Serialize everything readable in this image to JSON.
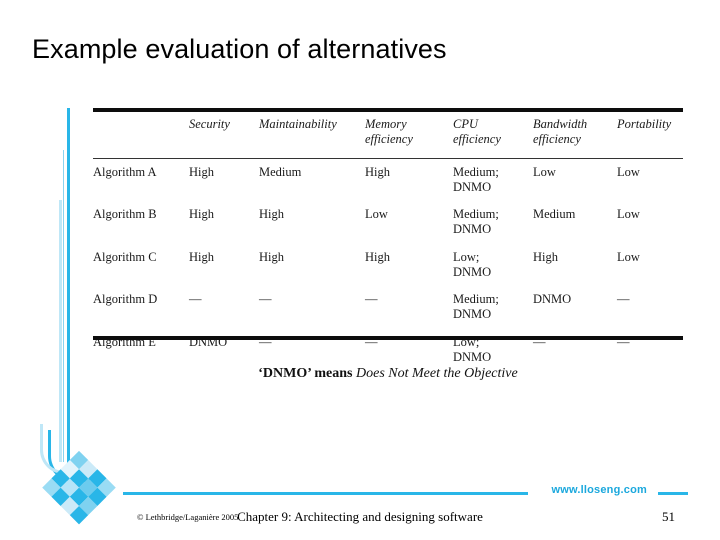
{
  "slide": {
    "title": "Example evaluation of alternatives"
  },
  "table": {
    "columns": [
      "",
      "Security",
      "Maintainability",
      "Memory\nefficiency",
      "CPU\nefficiency",
      "Bandwidth\nefficiency",
      "Portability"
    ],
    "rows": [
      {
        "algorithm": "Algorithm A",
        "security": "High",
        "maintainability": "Medium",
        "memory_efficiency": "High",
        "cpu_efficiency": "Medium;\nDNMO",
        "bandwidth_efficiency": "Low",
        "portability": "Low"
      },
      {
        "algorithm": "Algorithm B",
        "security": "High",
        "maintainability": "High",
        "memory_efficiency": "Low",
        "cpu_efficiency": "Medium;\nDNMO",
        "bandwidth_efficiency": "Medium",
        "portability": "Low"
      },
      {
        "algorithm": "Algorithm C",
        "security": "High",
        "maintainability": "High",
        "memory_efficiency": "High",
        "cpu_efficiency": "Low;\nDNMO",
        "bandwidth_efficiency": "High",
        "portability": "Low"
      },
      {
        "algorithm": "Algorithm D",
        "security": "—",
        "maintainability": "—",
        "memory_efficiency": "—",
        "cpu_efficiency": "Medium;\nDNMO",
        "bandwidth_efficiency": "DNMO",
        "portability": "—"
      },
      {
        "algorithm": "Algorithm E",
        "security": "DNMO",
        "maintainability": "—",
        "memory_efficiency": "—",
        "cpu_efficiency": "Low;\nDNMO",
        "bandwidth_efficiency": "—",
        "portability": "—"
      }
    ]
  },
  "caption": {
    "bold_part": "‘DNMO’ means ",
    "italic_part": "Does Not Meet the Objective"
  },
  "footer": {
    "url": "www.lloseng.com",
    "copyright": "© Lethbridge/Laganière 2005",
    "chapter": "Chapter 9: Architecting and designing software",
    "page_number": "51"
  },
  "colors": {
    "accent_cyan": "#29b6e8",
    "accent_light_cyan": "#bfe7f7",
    "url_cyan": "#1ba8dd",
    "rule_black": "#0d0d0d"
  }
}
